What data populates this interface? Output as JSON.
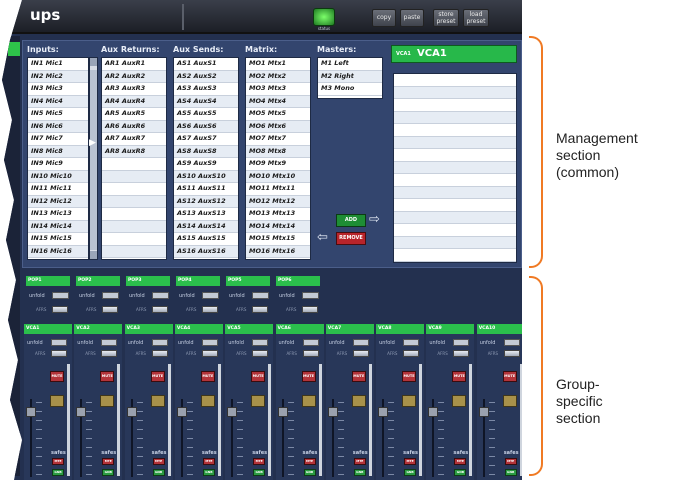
{
  "header": {
    "title": "ups",
    "status_label": "status",
    "buttons": [
      "copy",
      "paste",
      "store preset",
      "load preset"
    ]
  },
  "management": {
    "columns": [
      {
        "header": "Inputs:",
        "items": [
          "IN1 Mic1",
          "IN2 Mic2",
          "IN3 Mic3",
          "IN4 Mic4",
          "IN5 Mic5",
          "IN6 Mic6",
          "IN7 Mic7",
          "IN8 Mic8",
          "IN9 Mic9",
          "IN10 Mic10",
          "IN11 Mic11",
          "IN12 Mic12",
          "IN13 Mic13",
          "IN14 Mic14",
          "IN15 Mic15",
          "IN16 Mic16"
        ]
      },
      {
        "header": "Aux Returns:",
        "items": [
          "AR1 AuxR1",
          "AR2 AuxR2",
          "AR3 AuxR3",
          "AR4 AuxR4",
          "AR5 AuxR5",
          "AR6 AuxR6",
          "AR7 AuxR7",
          "AR8 AuxR8"
        ]
      },
      {
        "header": "Aux Sends:",
        "items": [
          "AS1 AuxS1",
          "AS2 AuxS2",
          "AS3 AuxS3",
          "AS4 AuxS4",
          "AS5 AuxS5",
          "AS6 AuxS6",
          "AS7 AuxS7",
          "AS8 AuxS8",
          "AS9 AuxS9",
          "AS10 AuxS10",
          "AS11 AuxS11",
          "AS12 AuxS12",
          "AS13 AuxS13",
          "AS14 AuxS14",
          "AS15 AuxS15",
          "AS16 AuxS16"
        ]
      },
      {
        "header": "Matrix:",
        "items": [
          "MO1 Mtx1",
          "MO2 Mtx2",
          "MO3 Mtx3",
          "MO4 Mtx4",
          "MO5 Mtx5",
          "MO6 Mtx6",
          "MO7 Mtx7",
          "MO8 Mtx8",
          "MO9 Mtx9",
          "MO10 Mtx10",
          "MO11 Mtx11",
          "MO12 Mtx12",
          "MO13 Mtx13",
          "MO14 Mtx14",
          "MO15 Mtx15",
          "MO16 Mtx16"
        ]
      },
      {
        "header": "Masters:",
        "items": [
          "M1 Left",
          "M2 Right",
          "M3 Mono"
        ]
      }
    ],
    "add_label": "ADD",
    "remove_label": "REMOVE",
    "vca_tag": "VCA1",
    "vca_name": "VCA1"
  },
  "pops": [
    {
      "label": "POP1"
    },
    {
      "label": "POP2"
    },
    {
      "label": "POP3"
    },
    {
      "label": "POP4"
    },
    {
      "label": "POP5"
    },
    {
      "label": "POP6"
    }
  ],
  "pop_unfold_label": "unfold",
  "pop_afrs_label": "AFRS",
  "strips": [
    {
      "label": "VCA1"
    },
    {
      "label": "VCA2"
    },
    {
      "label": "VCA3"
    },
    {
      "label": "VCA4"
    },
    {
      "label": "VCA5"
    },
    {
      "label": "VCA6"
    },
    {
      "label": "VCA7"
    },
    {
      "label": "VCA8"
    },
    {
      "label": "VCA9"
    },
    {
      "label": "VCA10"
    }
  ],
  "strip_text": {
    "unfold": "unfold",
    "afrs": "AFRS",
    "mute": "MUTE",
    "safes": "safes",
    "mte": "MTE",
    "gnb": "GNB"
  },
  "annotations": {
    "management": [
      "Management",
      "section",
      "(common)"
    ],
    "group": [
      "Group-",
      "specific",
      "section"
    ]
  },
  "colors": {
    "accent_orange": "#f07a24",
    "tab_green": "#2bbf4c",
    "panel_blue": "#33456e"
  }
}
